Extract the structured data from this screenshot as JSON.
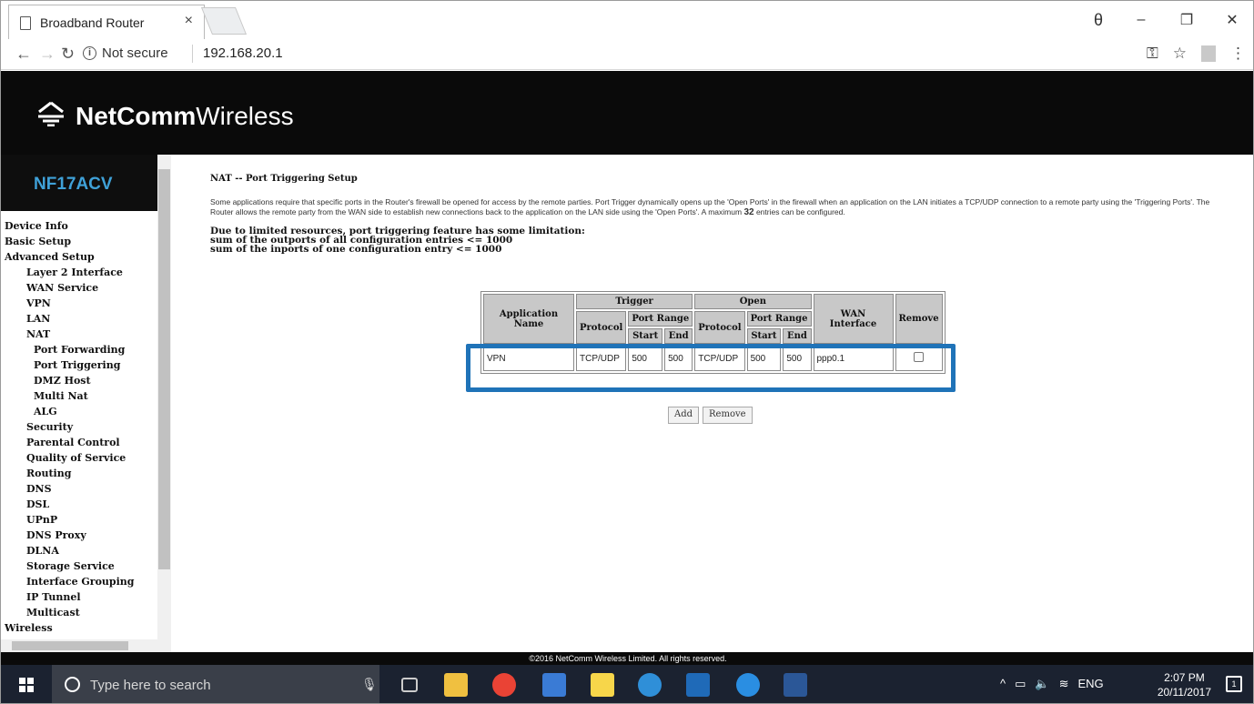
{
  "browser": {
    "tab_title": "Broadband Router",
    "tab_close": "×",
    "security_label": "Not secure",
    "url": "192.168.20.1",
    "window_controls": [
      "θ",
      "–",
      "❐",
      "✕"
    ]
  },
  "brand": {
    "name_bold": "NetComm",
    "name_light": "Wireless"
  },
  "sidebar": {
    "model": "NF17ACV",
    "menu": [
      {
        "label": "Device Info",
        "level": 0
      },
      {
        "label": "Basic Setup",
        "level": 0
      },
      {
        "label": "Advanced Setup",
        "level": 0
      },
      {
        "label": "Layer 2 Interface",
        "level": 1
      },
      {
        "label": "WAN Service",
        "level": 1
      },
      {
        "label": "VPN",
        "level": 1
      },
      {
        "label": "LAN",
        "level": 1
      },
      {
        "label": "NAT",
        "level": 1
      },
      {
        "label": "Port Forwarding",
        "level": 2
      },
      {
        "label": "Port Triggering",
        "level": 2
      },
      {
        "label": "DMZ Host",
        "level": 2
      },
      {
        "label": "Multi Nat",
        "level": 2
      },
      {
        "label": "ALG",
        "level": 2
      },
      {
        "label": "Security",
        "level": 1
      },
      {
        "label": "Parental Control",
        "level": 1
      },
      {
        "label": "Quality of Service",
        "level": 1
      },
      {
        "label": "Routing",
        "level": 1
      },
      {
        "label": "DNS",
        "level": 1
      },
      {
        "label": "DSL",
        "level": 1
      },
      {
        "label": "UPnP",
        "level": 1
      },
      {
        "label": "DNS Proxy",
        "level": 1
      },
      {
        "label": "DLNA",
        "level": 1
      },
      {
        "label": "Storage Service",
        "level": 1
      },
      {
        "label": "Interface Grouping",
        "level": 1
      },
      {
        "label": "IP Tunnel",
        "level": 1
      },
      {
        "label": "Multicast",
        "level": 1
      },
      {
        "label": "Wireless",
        "level": 0
      }
    ]
  },
  "main": {
    "heading": "NAT -- Port Triggering Setup",
    "description_pre": "Some applications require that specific ports in the Router's firewall be opened for access by the remote parties. Port Trigger dynamically opens up the 'Open Ports' in the firewall when an application on the LAN initiates a TCP/UDP connection to a remote party using the 'Triggering Ports'. The Router allows the remote party from the WAN side to establish new connections back to the application on the LAN side using the 'Open Ports'. A maximum",
    "description_max": "32",
    "description_post": "entries can be configured.",
    "limit_lines": [
      "Due to limited resources, port triggering feature has some limitation:",
      "sum of the outports of all configuration entries <= 1000",
      "sum of the inports of one configuration entry <= 1000"
    ],
    "table": {
      "headers": {
        "app_name": "Application Name",
        "trigger": "Trigger",
        "open": "Open",
        "protocol": "Protocol",
        "port_range": "Port Range",
        "start": "Start",
        "end": "End",
        "wan_interface": "WAN Interface",
        "remove": "Remove"
      },
      "rows": [
        {
          "app_name": "VPN",
          "trigger_protocol": "TCP/UDP",
          "trigger_start": "500",
          "trigger_end": "500",
          "open_protocol": "TCP/UDP",
          "open_start": "500",
          "open_end": "500",
          "wan_interface": "ppp0.1",
          "remove_checked": false
        }
      ]
    },
    "buttons": {
      "add": "Add",
      "remove": "Remove"
    },
    "footer": "©2016 NetComm Wireless Limited. All rights reserved."
  },
  "taskbar": {
    "search_placeholder": "Type here to search",
    "tray_lang": "ENG",
    "time": "2:07 PM",
    "date": "20/11/2017",
    "notifications": "1"
  },
  "colors": {
    "highlight": "#1f73b8",
    "model_text": "#3fa1d8",
    "banner_bg": "#0a0a0a"
  }
}
